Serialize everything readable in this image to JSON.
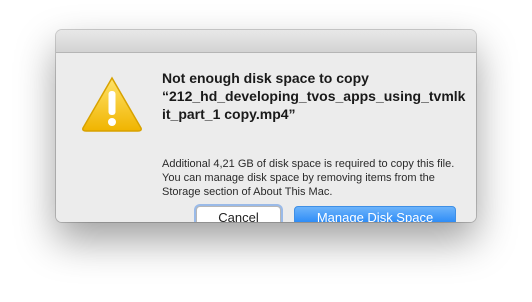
{
  "dialog": {
    "title": "Not enough disk space to copy\n“212_hd_developing_tvos_apps_using_tvmlk\nit_part_1 copy.mp4”",
    "message": "Additional 4,21 GB of disk space is required to copy this file. You can manage disk space by removing items from the Storage section of About This Mac.",
    "icon": "warning-triangle-icon",
    "buttons": {
      "cancel": "Cancel",
      "primary": "Manage Disk Space"
    }
  },
  "colors": {
    "primary_button": "#1f83f6",
    "warning_yellow": "#f4c21b",
    "dialog_background": "#ececec"
  }
}
